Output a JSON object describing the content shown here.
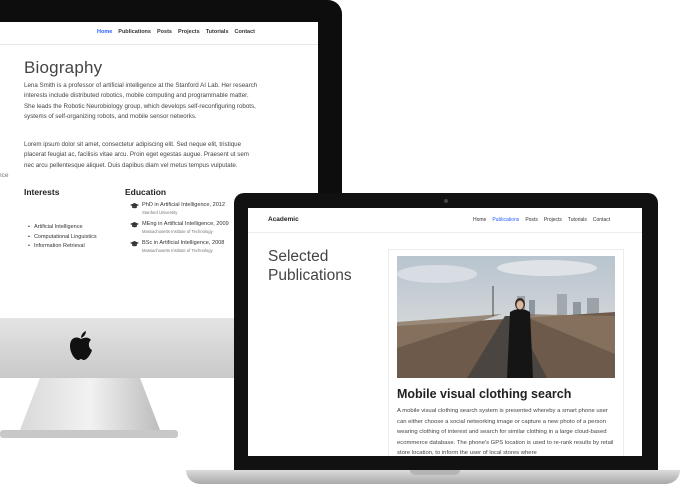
{
  "imac": {
    "nav": {
      "items": [
        "Home",
        "Publications",
        "Posts",
        "Projects",
        "Tutorials",
        "Contact"
      ],
      "active": "Home"
    },
    "bio_title": "Biography",
    "bio_p1": "Lena Smith is a professor of artificial intelligence at the Stanford AI Lab. Her research interests include distributed robotics, mobile computing and programmable matter. She leads the Robotic Neurobiology group, which develops self-reconfiguring robots, systems of self-organizing robots, and mobile sensor networks.",
    "bio_p2": "Lorem ipsum dolor sit amet, consectetur adipiscing elit. Sed neque elit, tristique placerat feugiat ac, facilisis vitae arcu. Proin eget egestas augue. Praesent ut sem nec arcu pellentesque aliquet. Duis dapibus diam vel metus tempus vulputate.",
    "side_fragment": "nce",
    "interests_heading": "Interests",
    "interests": [
      "Artificial Intelligence",
      "Computational Linguistics",
      "Information Retrieval"
    ],
    "education_heading": "Education",
    "education": [
      {
        "degree": "PhD in Artificial Intelligence, 2012",
        "institution": "Stanford University"
      },
      {
        "degree": "MEng in Artificial Intelligence, 2009",
        "institution": "Massachusetts Institute of Technology"
      },
      {
        "degree": "BSc in Artificial Intelligence, 2008",
        "institution": "Massachusetts Institute of Technology"
      }
    ]
  },
  "macbook": {
    "brand": "Academic",
    "nav": {
      "items": [
        "Home",
        "Publications",
        "Posts",
        "Projects",
        "Tutorials",
        "Contact"
      ],
      "active": "Publications"
    },
    "section_title": "Selected Publications",
    "publication": {
      "title": "Mobile visual clothing search",
      "abstract": "A mobile visual clothing search system is presented whereby a smart phone user can either choose a social networking image or capture a new photo of a person wearing clothing of interest and search for similar clothing in a large cloud-based ecommerce database. The phone's GPS location is used to re-rank results by retail store location, to inform the user of local stores where"
    }
  },
  "colors": {
    "accent": "#2962ff",
    "bezel": "#0d0d0d"
  },
  "icons": [
    "apple-logo-icon",
    "graduation-cap-icon"
  ]
}
